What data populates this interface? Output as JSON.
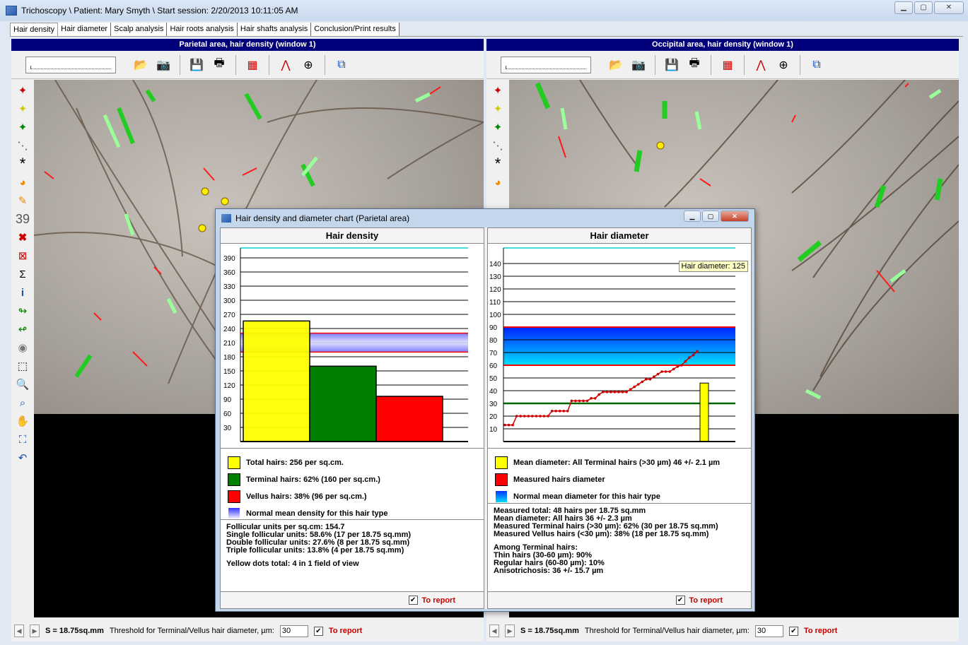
{
  "window": {
    "title": "Trichoscopy \\ Patient: Mary Smyth \\ Start session: 2/20/2013 10:11:05 AM"
  },
  "tabs": [
    {
      "label": "Hair density"
    },
    {
      "label": "Hair diameter"
    },
    {
      "label": "Scalp analysis"
    },
    {
      "label": "Hair roots analysis"
    },
    {
      "label": "Hair shafts analysis"
    },
    {
      "label": "Conclusion/Print results"
    }
  ],
  "left_pane": {
    "header": "Parietal area, hair density (window 1)",
    "status_s": "S = 18.75sq.mm",
    "threshold_label": "Threshold for Terminal/Vellus hair diameter, µm:",
    "threshold_value": "30",
    "report_label": "To report"
  },
  "right_pane": {
    "header": "Occipital area, hair density (window 1)",
    "status_s": "S = 18.75sq.mm",
    "threshold_label": "Threshold for Terminal/Vellus hair diameter, µm:",
    "threshold_value": "30",
    "report_label": "To report"
  },
  "dialog": {
    "title": "Hair density and diameter chart (Parietal area)",
    "density": {
      "heading": "Hair density",
      "legend": [
        {
          "label": "Total hairs: 256 per sq.cm.",
          "color": "#ffff00"
        },
        {
          "label": "Terminal hairs: 62% (160 per sq.cm.)",
          "color": "#008000"
        },
        {
          "label": "Vellus hairs: 38% (96 per sq.cm.)",
          "color": "#ff0000"
        },
        {
          "label": "Normal mean density for this hair type",
          "color": "#6666ff"
        }
      ],
      "stats": [
        "Follicular units per sq.cm: 154.7",
        "Single follicular units: 58.6% (17  per 18.75 sq.mm)",
        "Double follicular units: 27.6% (8  per 18.75 sq.mm)",
        "Triple follicular units: 13.8% (4  per 18.75 sq.mm)"
      ],
      "yellow_dots": "Yellow dots total: 4 in 1 field of view",
      "report_label": "To report"
    },
    "diameter": {
      "heading": "Hair diameter",
      "tooltip": "Hair diameter: 125",
      "legend": [
        {
          "label": "Mean diameter: All Terminal hairs (>30 µm) 46 +/- 2.1 µm",
          "color": "#ffff00"
        },
        {
          "label": "Measured hairs diameter",
          "color": "#ff0000"
        },
        {
          "label": "Normal mean diameter for this hair type",
          "color": "#0099ff"
        }
      ],
      "stats": [
        "Measured total: 48 hairs per 18.75 sq.mm",
        "Mean diameter: All hairs 36 +/- 2.3 µm",
        "Measured Terminal hairs (>30 µm): 62% (30 per 18.75 sq.mm)",
        "Measured Vellus hairs (<30 µm): 38% (18 per 18.75 sq.mm)"
      ],
      "terminal_heading": "Among Terminal hairs:",
      "terminal_stats": [
        "Thin hairs (30-60 µm): 90%",
        "Regular hairs (60-80 µm): 10%",
        "Anisotrichosis: 36 +/- 15.7 µm"
      ],
      "report_label": "To report"
    }
  },
  "chart_data": [
    {
      "type": "bar",
      "title": "Hair density",
      "categories": [
        "Total hairs",
        "Terminal hairs",
        "Vellus hairs"
      ],
      "values": [
        256,
        160,
        96
      ],
      "colors": [
        "#ffff00",
        "#008000",
        "#ff0000"
      ],
      "yticks": [
        30,
        60,
        90,
        120,
        150,
        180,
        210,
        240,
        270,
        300,
        330,
        360,
        390
      ],
      "ylim": [
        0,
        405
      ],
      "normal_band": [
        190,
        230
      ],
      "grid": true
    },
    {
      "type": "line",
      "title": "Hair diameter",
      "yticks": [
        10,
        20,
        30,
        40,
        50,
        60,
        70,
        80,
        90,
        100,
        110,
        120,
        130,
        140
      ],
      "ylim": [
        0,
        150
      ],
      "normal_band": [
        60,
        90
      ],
      "threshold": 30,
      "mean_bar": 46,
      "series": [
        {
          "values": [
            13,
            13,
            13,
            20,
            20,
            20,
            20,
            20,
            20,
            20,
            20,
            20,
            24,
            24,
            24,
            24,
            24,
            32,
            32,
            32,
            32,
            32,
            34,
            34,
            37,
            39,
            39,
            39,
            39,
            39,
            39,
            39,
            41,
            43,
            45,
            47,
            49,
            49,
            51,
            53,
            55,
            55,
            55,
            57,
            59,
            60,
            63,
            66,
            68,
            71
          ]
        }
      ],
      "grid": true
    }
  ]
}
